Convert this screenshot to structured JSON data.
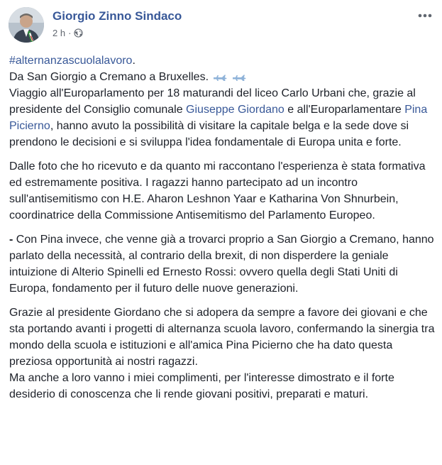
{
  "post": {
    "author": "Giorgio Zinno Sindaco",
    "time": "2 h",
    "privacy_separator": "·",
    "icons": {
      "privacy": "globe-icon",
      "more": "more-options-icon",
      "emoji": "airplane-icon"
    },
    "colors": {
      "link": "#385898",
      "text": "#1d2129",
      "meta": "#616770"
    },
    "hashtag": "#alternanzascuolalavoro",
    "p1": {
      "hashtag_suffix": ".",
      "line2": "Da San Giorgio a Cremano a Bruxelles.",
      "text_a": "Viaggio all'Europarlamento per 18 maturandi del liceo Carlo Urbani che, grazie al presidente del Consiglio comunale ",
      "link_giordano": "Giuseppe Giordano",
      "text_b": " e all'Europarlamentare ",
      "link_picierno": "Pina Picierno",
      "text_c": ", hanno avuto la possibilità di visitare la capitale belga e la sede dove si prendono le decisioni e si sviluppa l'idea fondamentale di Europa unita e forte."
    },
    "p2": "Dalle foto che ho ricevuto e da quanto mi raccontano l'esperienza è stata formativa ed estremamente positiva. I ragazzi hanno partecipato ad un incontro sull'antisemitismo con H.E. Aharon Leshnon Yaar e Katharina Von Shnurbein, coordinatrice della Commissione Antisemitismo del Parlamento Europeo.",
    "p3": {
      "dash": "-",
      "text": " Con Pina invece, che venne già a trovarci proprio a San Giorgio a Cremano, hanno parlato della necessità, al contrario della brexit, di non disperdere la geniale intuizione di Alterio Spinelli ed Ernesto Rossi: ovvero quella degli Stati Uniti di Europa, fondamento per il futuro delle nuove generazioni."
    },
    "p4": {
      "line_a": "Grazie al presidente Giordano che si adopera da sempre a favore dei giovani e che sta portando avanti i progetti di alternanza scuola lavoro, confermando la sinergia tra mondo della scuola e istituzioni e all'amica Pina Picierno che ha dato questa preziosa opportunità ai nostri ragazzi.",
      "line_b": "Ma anche a loro vanno i miei complimenti, per l'interesse dimostrato e il forte desiderio di conoscenza che li rende giovani positivi, preparati e maturi."
    }
  }
}
